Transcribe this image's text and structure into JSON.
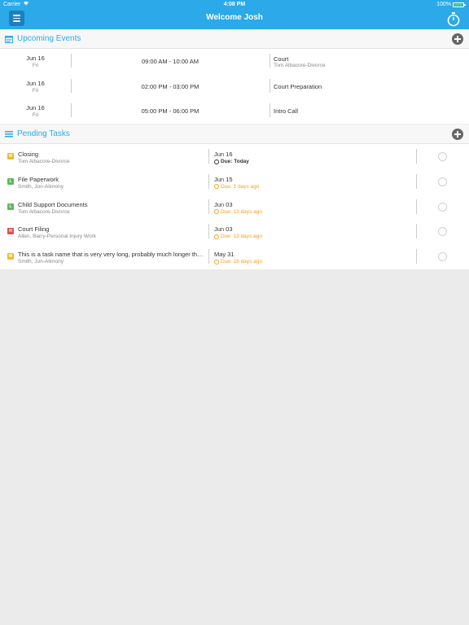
{
  "status_bar": {
    "carrier": "Carrier",
    "time": "4:08 PM",
    "battery": "100%",
    "battery_level": 1.0
  },
  "nav": {
    "title": "Welcome Josh",
    "menu_icon": "hamburger-menu-icon",
    "timer_icon": "stopwatch-icon"
  },
  "colors": {
    "brand": "#2ba9e8",
    "late": "#f5a11c",
    "priority_medium": "#f0bb2b",
    "priority_low": "#5cb85c",
    "priority_high": "#d9534f"
  },
  "upcoming_events": {
    "title": "Upcoming Events",
    "icon": "calendar-icon",
    "add_icon": "add-circle-icon",
    "items": [
      {
        "date": "Jun 16",
        "day": "Fri",
        "time": "09:00 AM - 10:00 AM",
        "title": "Court",
        "subtitle": "Tom Albacore-Divorce"
      },
      {
        "date": "Jun 16",
        "day": "Fri",
        "time": "02:00 PM - 03:00 PM",
        "title": "Court Preparation",
        "subtitle": ""
      },
      {
        "date": "Jun 16",
        "day": "Fri",
        "time": "05:00 PM - 06:00 PM",
        "title": "Intro Call",
        "subtitle": ""
      }
    ]
  },
  "pending_tasks": {
    "title": "Pending Tasks",
    "icon": "tasks-list-icon",
    "add_icon": "add-circle-icon",
    "items": [
      {
        "priority": "M",
        "name": "Closing",
        "client": "Tom Albacore-Divorce",
        "due_date": "Jun 16",
        "due_text": "Due: Today",
        "status": "today"
      },
      {
        "priority": "L",
        "name": "File Paperwork",
        "client": "Smith, Jon-Alimony",
        "due_date": "Jun 15",
        "due_text": "Due: 1 days ago",
        "status": "late"
      },
      {
        "priority": "L",
        "name": "Child Support Documents",
        "client": "Tom Albacore-Divorce",
        "due_date": "Jun 03",
        "due_text": "Due: 13 days ago",
        "status": "late"
      },
      {
        "priority": "H",
        "name": "Court Filing",
        "client": "Allen, Barry-Personal Injury Work",
        "due_date": "Jun 03",
        "due_text": "Due: 13 days ago",
        "status": "late"
      },
      {
        "priority": "M",
        "name": "This is a task name that is very very long, probably much longer than most task names",
        "client": "Smith, Jon-Alimony",
        "due_date": "May 31",
        "due_text": "Due: 16 days ago",
        "status": "late"
      }
    ]
  }
}
